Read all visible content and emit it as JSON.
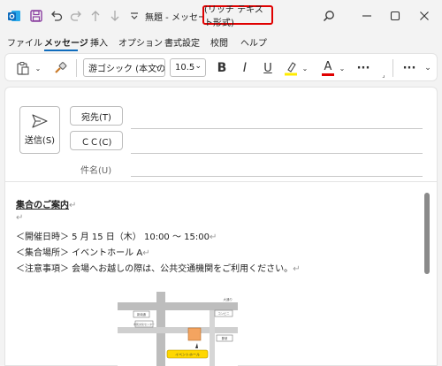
{
  "title": {
    "prefix": "無題 - メッセージ",
    "format": "(リッチ テキスト形式)"
  },
  "menu": {
    "items": [
      "ファイル",
      "メッセージ",
      "挿入",
      "オプション",
      "書式設定",
      "校閲",
      "ヘルプ"
    ],
    "active": "メッセージ"
  },
  "ribbon": {
    "font_name": "游ゴシック (本文の",
    "font_size": "10.5",
    "bold": "B",
    "italic": "I",
    "underline": "U",
    "font_color_letter": "A",
    "more": "···"
  },
  "compose": {
    "send_label": "送信(S)",
    "to_label": "宛先(T)",
    "cc_label": "ＣＣ(C)",
    "subject_label": "件名(U)"
  },
  "body": {
    "heading": "集合のご案内",
    "pilcrow": "↵",
    "lines": [
      "＜開催日時＞ 5 月 15 日（木） 10:00 〜 15:00",
      "＜集合場所＞ イベントホール A",
      "＜注意事項＞ 会場へお越しの際は、公共交通機関をご利用ください。"
    ]
  },
  "map": {
    "labels": [
      "大通り",
      "新南通",
      "コンビニ",
      "市民文化センター",
      "郵便",
      "イベントホール"
    ]
  },
  "colors": {
    "accent": "#0f6cbd",
    "highlight_border": "#e00000",
    "text_highlight": "#ffeb00",
    "font_color": "#e00000",
    "outlook_blue": "#0f6cbd",
    "save_purple": "#8a3fa0",
    "map_building": "#f4a460",
    "map_marker": "#ffd700"
  },
  "icons": [
    "outlook-icon",
    "save-icon",
    "undo-icon",
    "redo-icon",
    "up-icon",
    "down-icon",
    "customize-icon",
    "search-icon",
    "minimize-icon",
    "maximize-icon",
    "close-icon",
    "paste-icon",
    "format-painter-icon",
    "highlight-icon",
    "font-color-icon",
    "more-icon",
    "send-icon"
  ]
}
